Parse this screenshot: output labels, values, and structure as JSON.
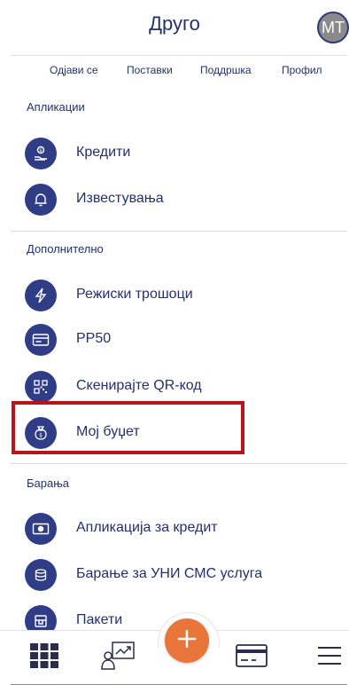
{
  "header": {
    "title": "Друго",
    "avatar_initials": "MT"
  },
  "top_links": [
    "Одјави се",
    "Поставки",
    "Поддршка",
    "Профил"
  ],
  "sections": {
    "applications": {
      "title": "Апликации",
      "items": [
        {
          "label": "Кредити",
          "icon": "money-hand-icon"
        },
        {
          "label": "Известувања",
          "icon": "bell-icon"
        }
      ]
    },
    "additional": {
      "title": "Дополнително",
      "items": [
        {
          "label": "Режиски трошоци",
          "icon": "lightning-icon"
        },
        {
          "label": "PP50",
          "icon": "card-document-icon"
        },
        {
          "label": "Скенирајте QR-код",
          "icon": "qr-code-icon"
        },
        {
          "label": "Мој буџет",
          "icon": "money-bag-icon"
        }
      ]
    },
    "requests": {
      "title": "Барања",
      "items": [
        {
          "label": "Апликација за кредит",
          "icon": "banknote-icon"
        },
        {
          "label": "Барање за УНИ СМС услуга",
          "icon": "coins-icon"
        },
        {
          "label": "Пакети",
          "icon": "package-icon"
        }
      ]
    }
  },
  "colors": {
    "primary": "#2f3d87",
    "accent": "#e8763a",
    "highlight": "#b8141a",
    "text": "#24306b"
  },
  "bottom_nav": [
    "grid-icon",
    "investment-icon",
    "plus-icon",
    "card-icon",
    "menu-icon"
  ]
}
